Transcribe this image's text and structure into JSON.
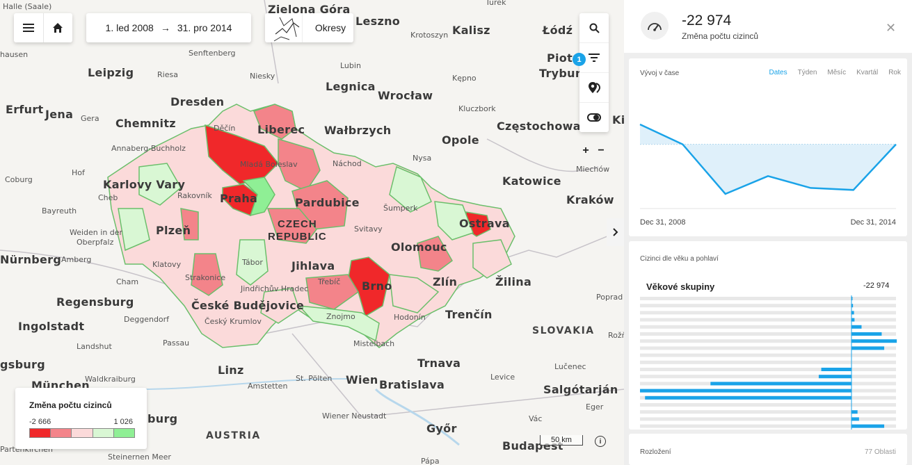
{
  "map": {
    "cities_big": [
      {
        "name": "Zielona Góra"
      },
      {
        "name": "Leszno"
      },
      {
        "name": "Kalisz"
      },
      {
        "name": "Łódź"
      },
      {
        "name": "Leipzig"
      },
      {
        "name": "Legnica"
      },
      {
        "name": "Wrocław"
      },
      {
        "name": "Dresden"
      },
      {
        "name": "Erfurt"
      },
      {
        "name": "Jena"
      },
      {
        "name": "Chemnitz"
      },
      {
        "name": "Wałbrzych"
      },
      {
        "name": "Opole"
      },
      {
        "name": "Częstochowa"
      },
      {
        "name": "Katowice"
      },
      {
        "name": "Kraków"
      },
      {
        "name": "Nürnberg"
      },
      {
        "name": "Regensburg"
      },
      {
        "name": "Ingolstadt"
      },
      {
        "name": "gsburg"
      },
      {
        "name": "München"
      },
      {
        "name": "Linz"
      },
      {
        "name": "Wien"
      },
      {
        "name": "Bratislava"
      },
      {
        "name": "Trnava"
      },
      {
        "name": "Žilina"
      },
      {
        "name": "Salgótarján"
      },
      {
        "name": "Győr"
      },
      {
        "name": "Budapest"
      },
      {
        "name": "burg"
      },
      {
        "name": "Piotr"
      },
      {
        "name": "Trybun"
      },
      {
        "name": "Ki"
      }
    ],
    "cities_cz": [
      {
        "name": "Liberec"
      },
      {
        "name": "Karlovy Vary"
      },
      {
        "name": "Praha"
      },
      {
        "name": "Pardubice"
      },
      {
        "name": "Plzeň"
      },
      {
        "name": "Olomouc"
      },
      {
        "name": "Ostrava"
      },
      {
        "name": "Jihlava"
      },
      {
        "name": "Zlín"
      },
      {
        "name": "Brno"
      },
      {
        "name": "České Budějovice"
      },
      {
        "name": "Trenčín"
      }
    ],
    "cities_small": [
      {
        "name": "Halle (Saale)"
      },
      {
        "name": "Turek"
      },
      {
        "name": "Krotoszyn"
      },
      {
        "name": "hausen"
      },
      {
        "name": "Senftenberg"
      },
      {
        "name": "Lubin"
      },
      {
        "name": "Riesa"
      },
      {
        "name": "Niesky"
      },
      {
        "name": "Kępno"
      },
      {
        "name": "Gera"
      },
      {
        "name": "Kluczbork"
      },
      {
        "name": "Annaberg-Buchholz"
      },
      {
        "name": "Děčín"
      },
      {
        "name": "Náchod"
      },
      {
        "name": "Nysa"
      },
      {
        "name": "Hof"
      },
      {
        "name": "Mladá Boleslav"
      },
      {
        "name": "Coburg"
      },
      {
        "name": "Rakovník"
      },
      {
        "name": "Cheb"
      },
      {
        "name": "Bayreuth"
      },
      {
        "name": "Šumperk"
      },
      {
        "name": "Weiden in der"
      },
      {
        "name": "Oberpfalz"
      },
      {
        "name": "Svitavy"
      },
      {
        "name": "Amberg"
      },
      {
        "name": "Klatovy"
      },
      {
        "name": "Tábor"
      },
      {
        "name": "Cham"
      },
      {
        "name": "Strakonice"
      },
      {
        "name": "Jindřichův Hradec"
      },
      {
        "name": "Třebíč"
      },
      {
        "name": "Deggendorf"
      },
      {
        "name": "Český Krumlov"
      },
      {
        "name": "Znojmo"
      },
      {
        "name": "Hodonín"
      },
      {
        "name": "Landshut"
      },
      {
        "name": "Passau"
      },
      {
        "name": "Mistelbach"
      },
      {
        "name": "Amstetten"
      },
      {
        "name": "St. Pölten"
      },
      {
        "name": "Waldkraiburg"
      },
      {
        "name": "Wiener Neustadt"
      },
      {
        "name": "Levice"
      },
      {
        "name": "Lučenec"
      },
      {
        "name": "Eger"
      },
      {
        "name": "Vác"
      },
      {
        "name": "Rožň"
      },
      {
        "name": "Poprad"
      },
      {
        "name": "Partenkirchen"
      },
      {
        "name": "Steinernen Meer"
      },
      {
        "name": "Pápa"
      },
      {
        "name": "Miechów"
      }
    ],
    "countries": {
      "cz_line1": "CZECH",
      "cz_line2": "REPUBLIC",
      "sk": "SLOVAKIA",
      "at": "AUSTRIA"
    }
  },
  "toolbar": {
    "date_from": "1. led 2008",
    "date_arrow": "→",
    "date_to": "31. pro 2014",
    "layer_label": "Okresy",
    "filter_badge": "1"
  },
  "legend": {
    "title": "Změna počtu cizinců",
    "min": "-2 666",
    "max": "1 026",
    "colors": [
      "#f0282a",
      "#f3848a",
      "#fbdada",
      "#d9f7d4",
      "#8fef95"
    ]
  },
  "scale_label": "50 km",
  "info_glyph": "i",
  "panel": {
    "value": "-22 974",
    "subtitle": "Změna počtu cizinců",
    "timeline": {
      "title": "Vývoj v čase",
      "tabs": [
        "Dates",
        "Týden",
        "Měsíc",
        "Kvartál",
        "Rok"
      ],
      "active_tab": "Dates",
      "start_label": "Dec 31, 2008",
      "end_label": "Dec 31, 2014",
      "values": [
        1,
        0,
        -2.5,
        -1.6,
        -2.2,
        -2.3,
        0
      ],
      "accent": "#1aa3e8"
    },
    "age": {
      "title": "Cizinci dle věku a pohlaví",
      "group_title": "Věkové skupiny",
      "total": "-22 974",
      "bars": [
        0.2,
        0.3,
        0.5,
        0.6,
        2.0,
        6.0,
        9.0,
        6.5,
        0,
        0,
        -6.0,
        -6.5,
        -28.0,
        -42.0,
        -41.0,
        0,
        1.2,
        1.5,
        6.5,
        7.5
      ]
    },
    "distribution": {
      "title": "Rozložení",
      "count": "77 Oblasti"
    }
  }
}
